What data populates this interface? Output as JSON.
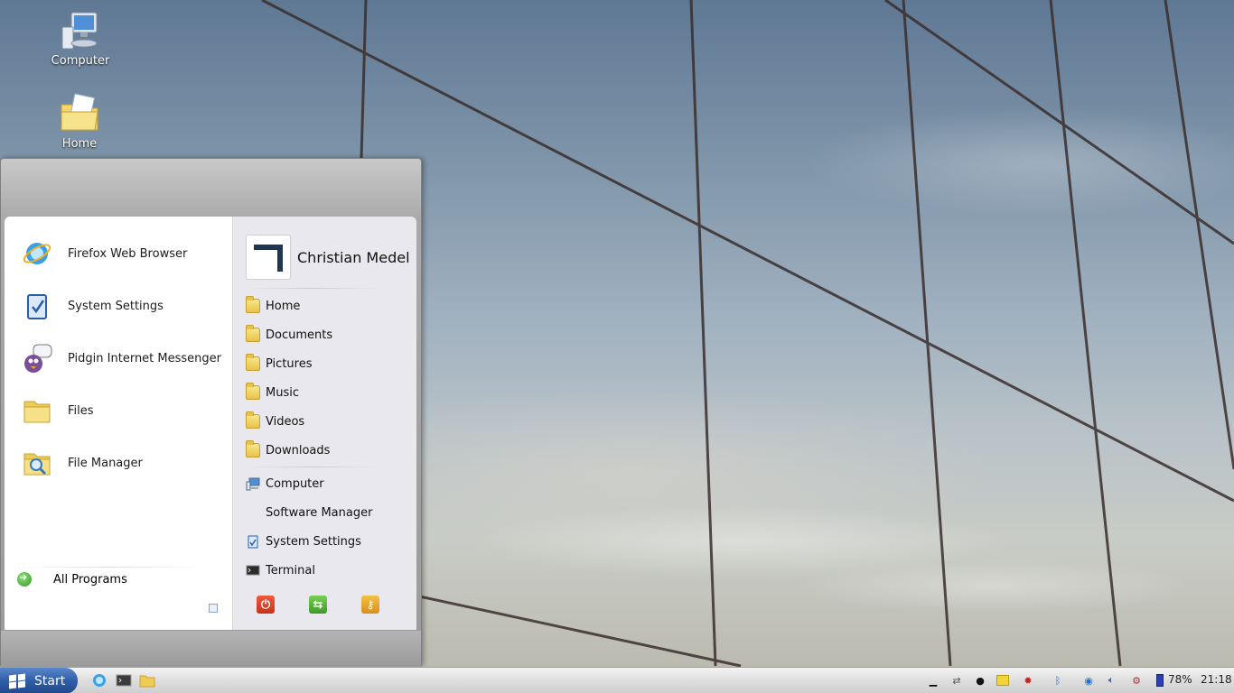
{
  "desktop": {
    "icons": [
      {
        "label": "Computer"
      },
      {
        "label": "Home"
      }
    ]
  },
  "start_menu": {
    "apps": [
      {
        "label": "Firefox Web Browser",
        "icon": "firefox-icon"
      },
      {
        "label": "System Settings",
        "icon": "settings-icon"
      },
      {
        "label": "Pidgin Internet Messenger",
        "icon": "pidgin-icon"
      },
      {
        "label": "Files",
        "icon": "folder-icon"
      },
      {
        "label": "File Manager",
        "icon": "file-manager-icon"
      }
    ],
    "all_programs": "All Programs",
    "user_name": "Christian Medel",
    "places": [
      {
        "label": "Home"
      },
      {
        "label": "Documents"
      },
      {
        "label": "Pictures"
      },
      {
        "label": "Music"
      },
      {
        "label": "Videos"
      },
      {
        "label": "Downloads"
      }
    ],
    "system": [
      {
        "label": "Computer"
      },
      {
        "label": "Software Manager"
      },
      {
        "label": "System Settings"
      },
      {
        "label": "Terminal"
      }
    ],
    "power_buttons": [
      "shutdown-icon",
      "switch-user-icon",
      "lock-icon"
    ]
  },
  "taskbar": {
    "start_label": "Start",
    "quick_launch": [
      "firefox-icon",
      "terminal-icon",
      "folder-icon"
    ],
    "battery": "78%",
    "clock": "21:18"
  },
  "colors": {
    "start_button": "#2f5ea8",
    "menu_frame": "#a9a9a9",
    "menu_right_pane": "#e8e8ee"
  }
}
